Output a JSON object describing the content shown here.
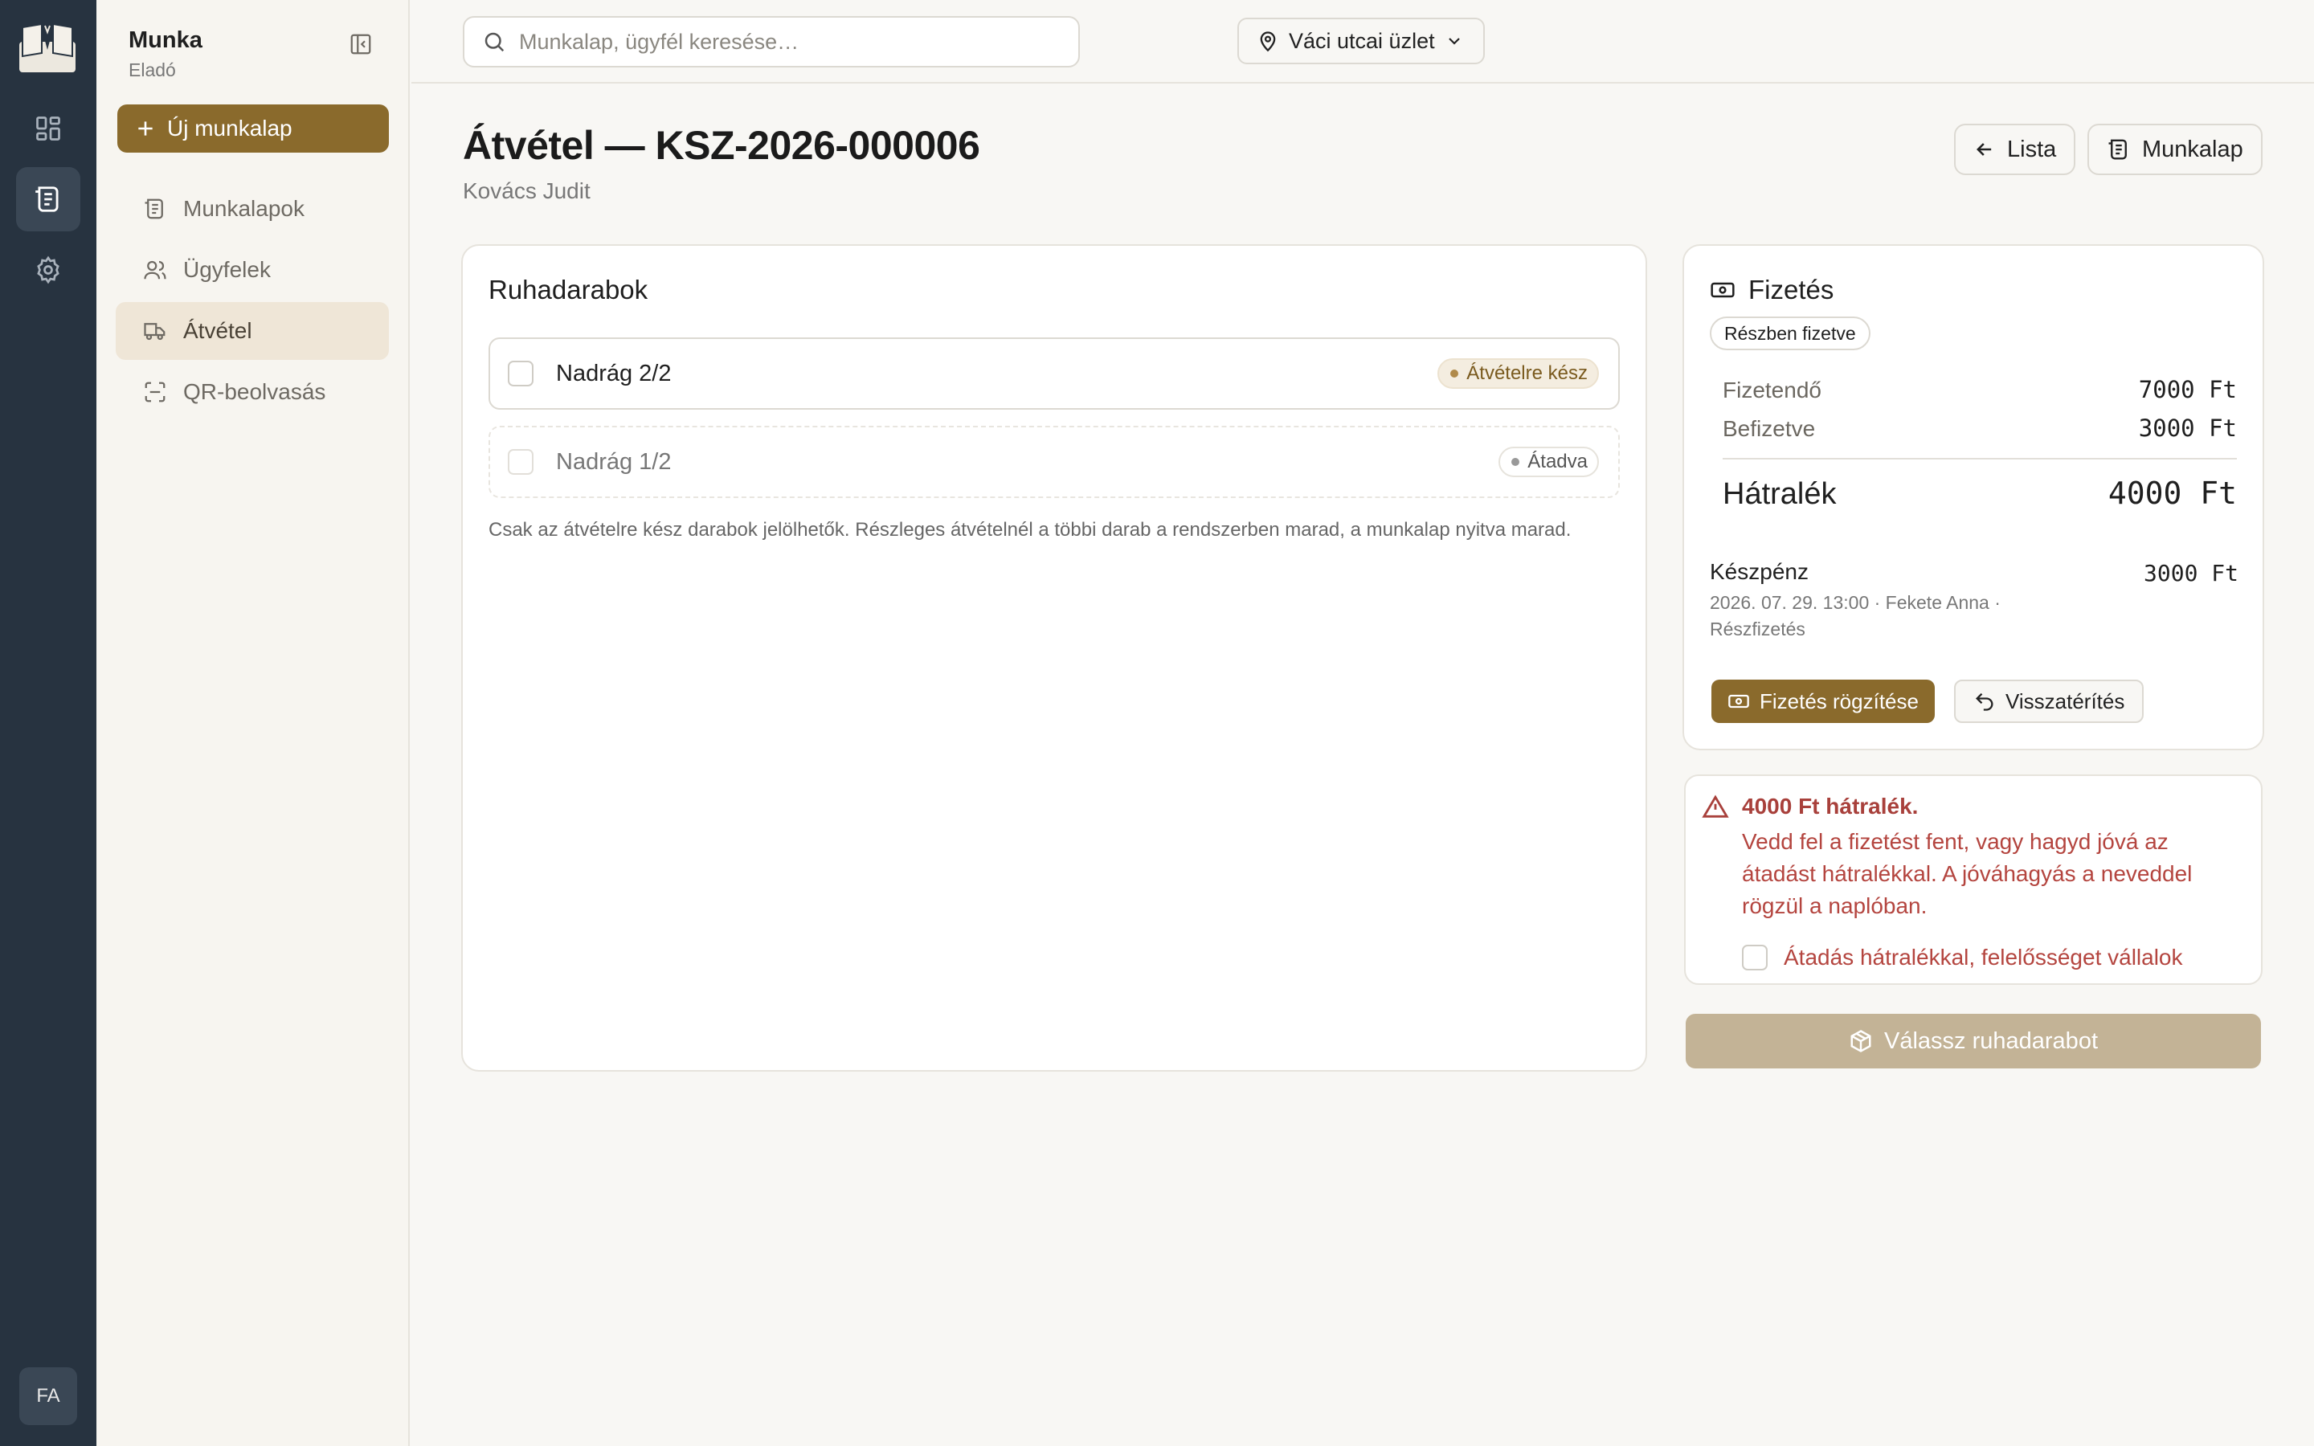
{
  "app": {
    "section_title": "Munka",
    "role": "Eladó",
    "user_initials": "FA"
  },
  "sidebar": {
    "new_button": "Új munkalap",
    "items": [
      {
        "label": "Munkalapok",
        "icon": "receipt-icon",
        "active": false
      },
      {
        "label": "Ügyfelek",
        "icon": "users-icon",
        "active": false
      },
      {
        "label": "Átvétel",
        "icon": "truck-icon",
        "active": true
      },
      {
        "label": "QR-beolvasás",
        "icon": "scan-icon",
        "active": false
      }
    ]
  },
  "topbar": {
    "search_placeholder": "Munkalap, ügyfél keresése…",
    "store": "Váci utcai üzlet"
  },
  "header": {
    "title": "Átvétel — KSZ-2026-000006",
    "customer": "Kovács Judit",
    "back_button": "Lista",
    "worksheet_button": "Munkalap"
  },
  "garments": {
    "heading": "Ruhadarabok",
    "items": [
      {
        "label": "Nadrág 2/2",
        "status": "Átvételre kész"
      },
      {
        "label": "Nadrág 1/2",
        "status": "Átadva"
      }
    ],
    "note": "Csak az átvételre kész darabok jelölhetők. Részleges átvételnél a többi darab a rendszerben marad, a munkalap nyitva marad."
  },
  "payment": {
    "heading": "Fizetés",
    "status": "Részben fizetve",
    "due_label": "Fizetendő",
    "due_value": "7000 Ft",
    "paid_label": "Befizetve",
    "paid_value": "3000 Ft",
    "balance_label": "Hátralék",
    "balance_value": "4000 Ft",
    "entry": {
      "method": "Készpénz",
      "meta": "2026. 07. 29. 13:00 · Fekete Anna · Részfizetés",
      "amount": "3000 Ft"
    },
    "record_button": "Fizetés rögzítése",
    "refund_button": "Visszatérítés"
  },
  "warning": {
    "title": "4000 Ft hátralék.",
    "text": "Vedd fel a fizetést fent, vagy hagyd jóvá az átadást hátralékkal. A jóváhagyás a neveddel rögzül a naplóban.",
    "ack_label": "Átadás hátralékkal, felelősséget vállalok"
  },
  "submit_button": "Válassz ruhadarabot",
  "colors": {
    "rail": "#273340",
    "accent": "#8a6a2c",
    "active_nav": "#efe6d7",
    "danger": "#b4453f",
    "submit_disabled": "#c3b396"
  }
}
